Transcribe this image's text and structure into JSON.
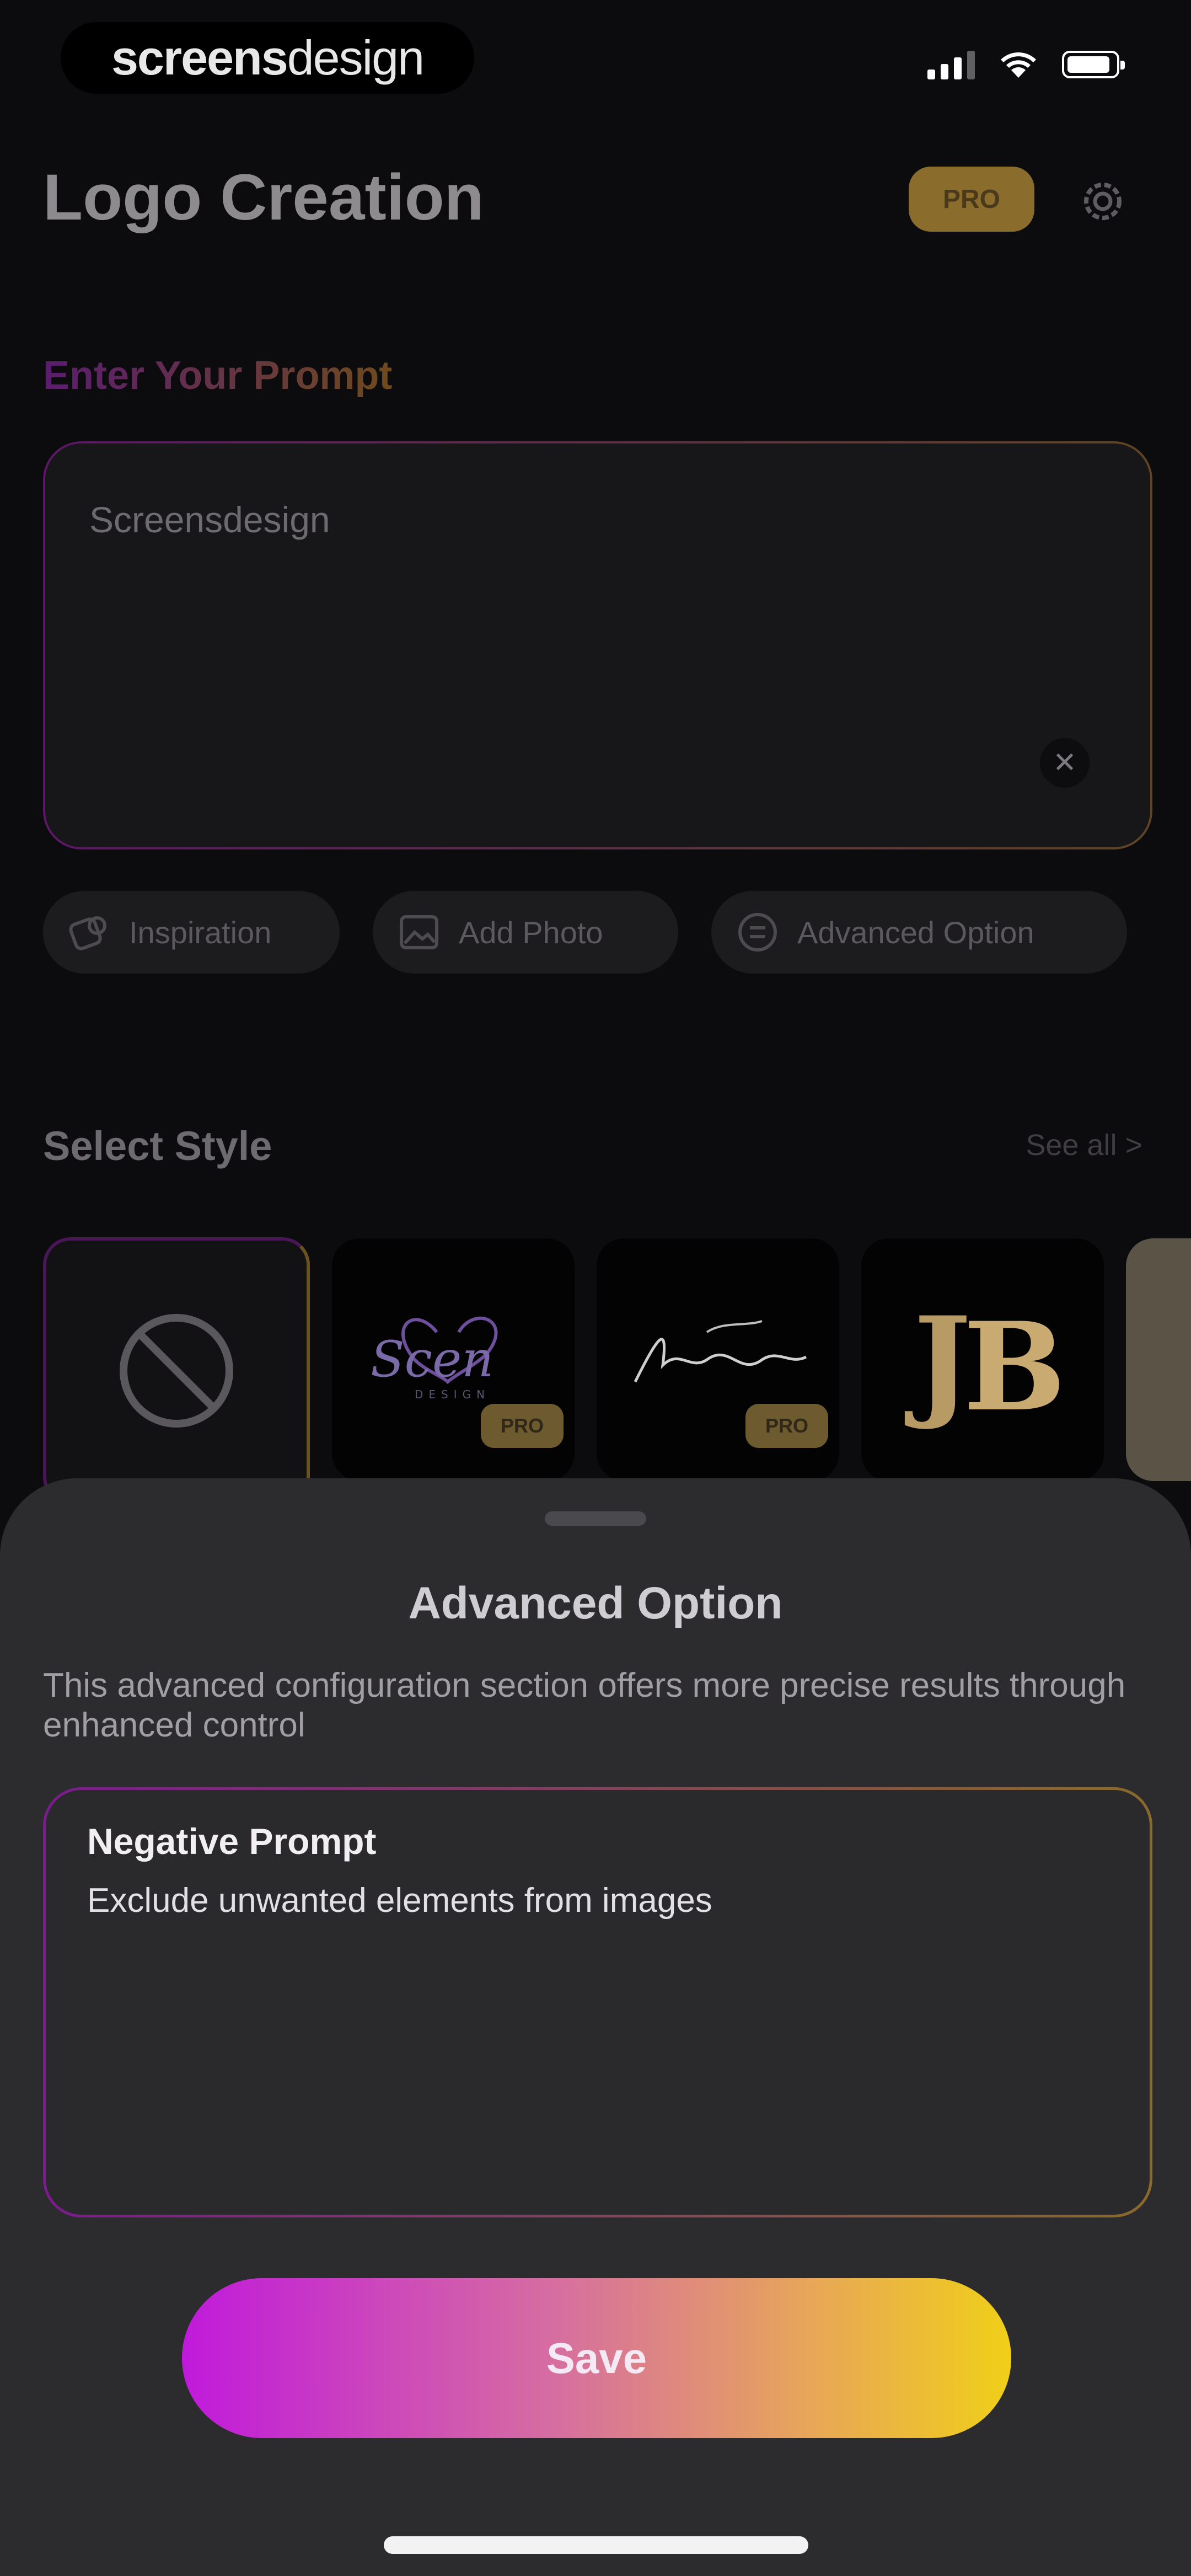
{
  "status_bar": {
    "brand_bold": "screens",
    "brand_light": "design"
  },
  "header": {
    "title": "Logo Creation",
    "pro_badge": "PRO",
    "settings_icon": "gear-icon"
  },
  "prompt": {
    "label": "Enter Your Prompt",
    "value": "Screensdesign",
    "clear_glyph": "✕"
  },
  "chips": [
    {
      "label": "Inspiration",
      "icon": "lightbulb-icon"
    },
    {
      "label": "Add Photo",
      "icon": "image-icon"
    },
    {
      "label": "Advanced Option",
      "icon": "sliders-icon"
    }
  ],
  "style_section": {
    "title": "Select Style",
    "see_all": "See all  >",
    "cards": [
      {
        "name": "none",
        "pro": ""
      },
      {
        "name": "script-heart",
        "pro": "PRO"
      },
      {
        "name": "signature",
        "pro": "PRO"
      },
      {
        "name": "monogram-jb",
        "pro": ""
      }
    ]
  },
  "sheet": {
    "title": "Advanced Option",
    "description": "This advanced configuration section offers more precise results through enhanced control",
    "negative_prompt": {
      "label": "Negative Prompt",
      "value": "Exclude unwanted elements from images"
    },
    "save_label": "Save"
  },
  "colors": {
    "accent_purple": "#c01adb",
    "accent_gold": "#f0cf18",
    "sheet_bg": "#2c2b2e"
  }
}
